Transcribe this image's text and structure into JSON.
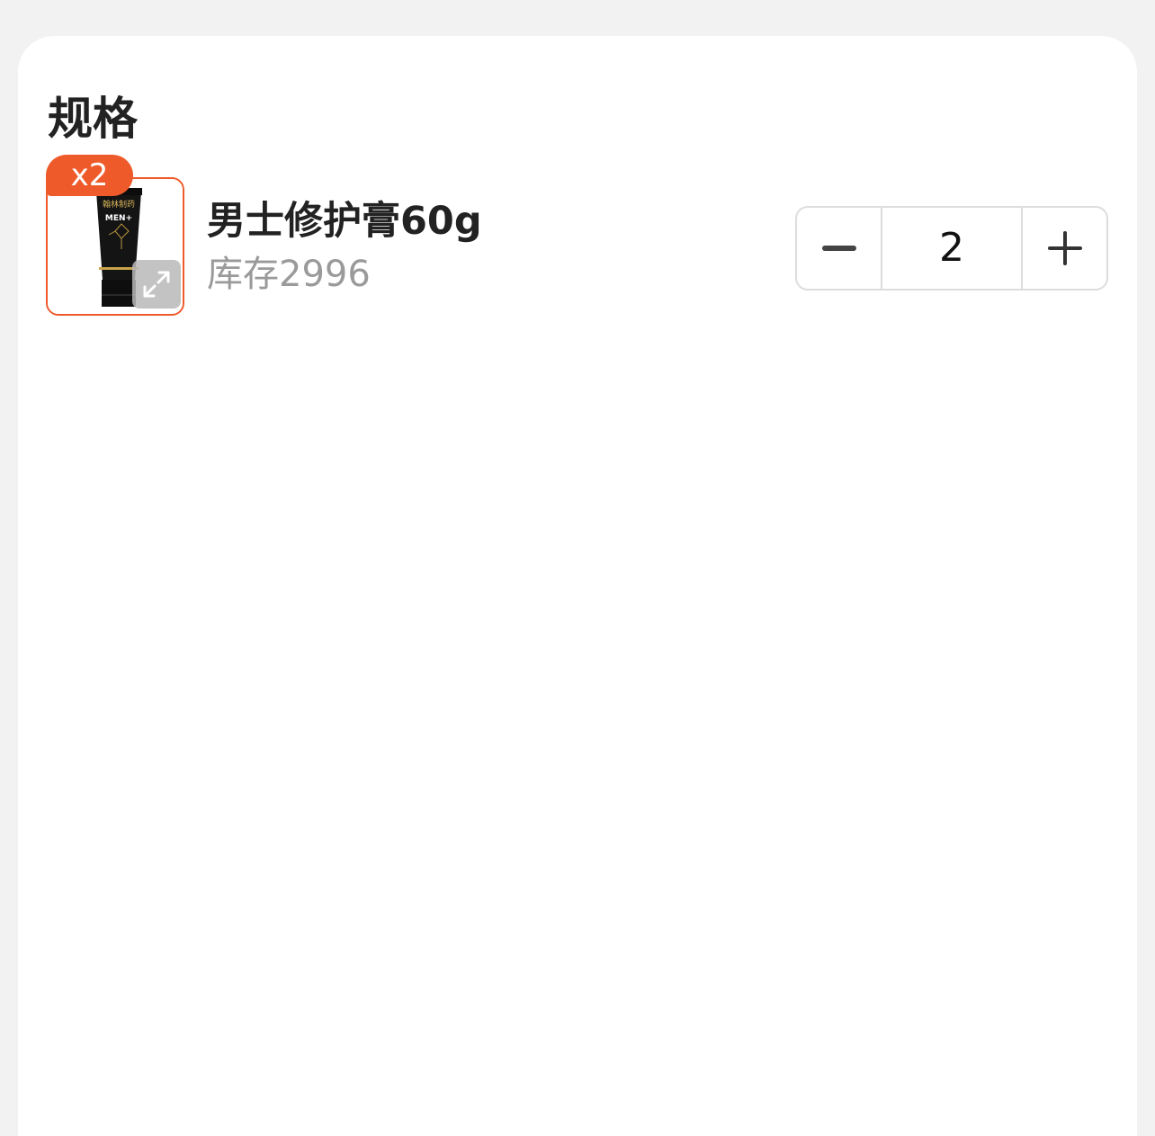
{
  "section": {
    "title": "规格"
  },
  "item": {
    "badge": "x2",
    "name": "男士修护膏60g",
    "stock": "库存2996",
    "quantity": "2",
    "image_icon": "product-tube-image",
    "expand_icon": "expand-arrows-icon",
    "image_text": {
      "brand": "翰林制药",
      "label": "MEN+"
    }
  },
  "stepper": {
    "minus_icon": "minus-icon",
    "plus_icon": "plus-icon"
  },
  "colors": {
    "accent": "#ef5a2b",
    "text_primary": "#222222",
    "text_secondary": "#9a9a9a",
    "background": "#f2f2f2",
    "panel": "#ffffff",
    "border": "#dddddd"
  }
}
